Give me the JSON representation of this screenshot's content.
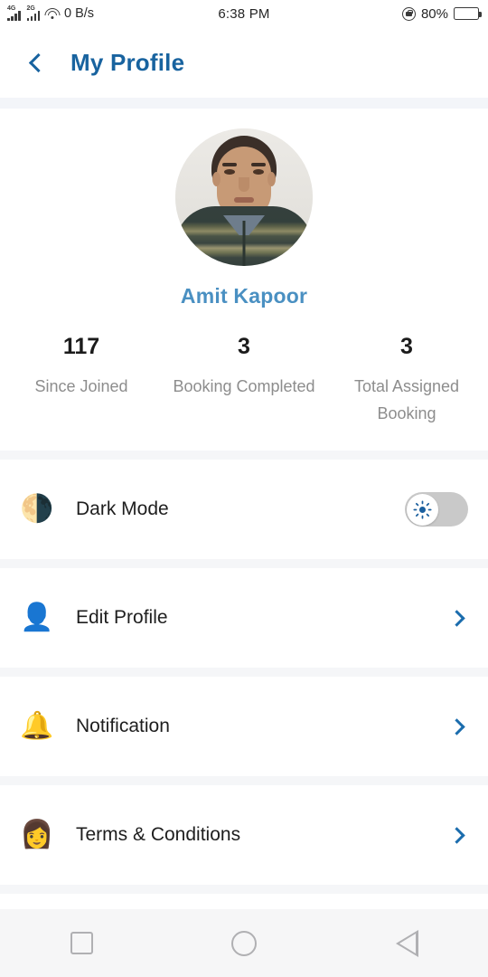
{
  "status_bar": {
    "network_1": "4G",
    "network_2": "2G",
    "wifi_icon": "wifi-icon",
    "data_speed": "0 B/s",
    "time": "6:38 PM",
    "rotation_lock_icon": "rotation-lock-icon",
    "battery_percent": "80%",
    "battery_level": 80
  },
  "header": {
    "back_icon": "chevron-left-icon",
    "title": "My Profile",
    "title_color": "#18639f"
  },
  "profile": {
    "avatar_alt": "user-avatar-photo",
    "name": "Amit Kapoor",
    "name_color": "#4a90c2",
    "stats": [
      {
        "value": "117",
        "label": "Since Joined"
      },
      {
        "value": "3",
        "label": "Booking\nCompleted"
      },
      {
        "value": "3",
        "label": "Total Assigned\nBooking"
      }
    ]
  },
  "settings": {
    "dark_mode": {
      "icon": "sun-half-dark-icon",
      "emoji": "🌗",
      "label": "Dark Mode",
      "toggle_state": "off",
      "toggle_track_color": "#c9c9c9",
      "toggle_knob_icon": "sun-icon"
    },
    "items": [
      {
        "icon": "user-edit-icon",
        "emoji": "👤",
        "label": "Edit Profile",
        "chevron": "chevron-right-icon"
      },
      {
        "icon": "bell-ringing-icon",
        "emoji": "🔔",
        "label": "Notification",
        "chevron": "chevron-right-icon"
      },
      {
        "icon": "support-agent-icon",
        "emoji": "👩",
        "label": "Terms & Conditions",
        "chevron": "chevron-right-icon"
      }
    ]
  },
  "nav_bar": {
    "recents": "square-icon",
    "home": "circle-icon",
    "back": "triangle-left-icon"
  }
}
